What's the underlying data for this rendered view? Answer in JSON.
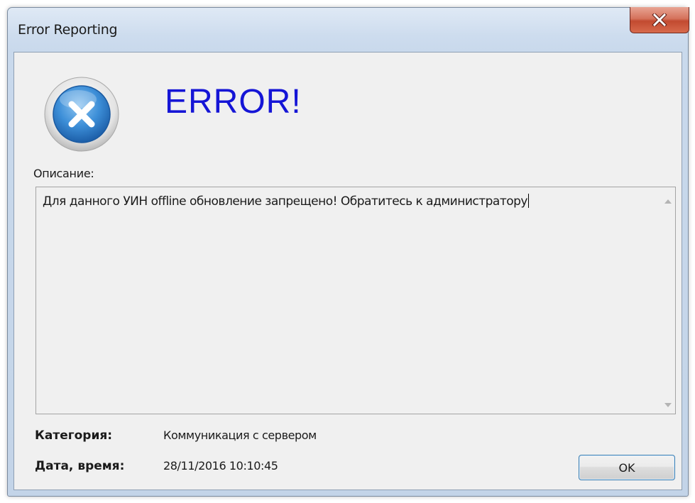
{
  "window": {
    "title": "Error Reporting"
  },
  "icons": {
    "close": "close-icon",
    "error": "error-icon",
    "scroll_up": "scroll-up-arrow-icon",
    "scroll_down": "scroll-down-arrow-icon"
  },
  "colors": {
    "heading": "#1515d6",
    "close_button": "#c24a30",
    "dialog_background": "#f0f0f0"
  },
  "main": {
    "heading": "ERROR!",
    "description_label": "Описание:",
    "description_text": "Для данного УИН offline обновление запрещено! Обратитесь к администратору"
  },
  "details": {
    "category_label": "Категория:",
    "category_value": "Коммуникация с сервером",
    "datetime_label": "Дата, время:",
    "datetime_value": "28/11/2016 10:10:45"
  },
  "buttons": {
    "ok_label": "OK"
  }
}
